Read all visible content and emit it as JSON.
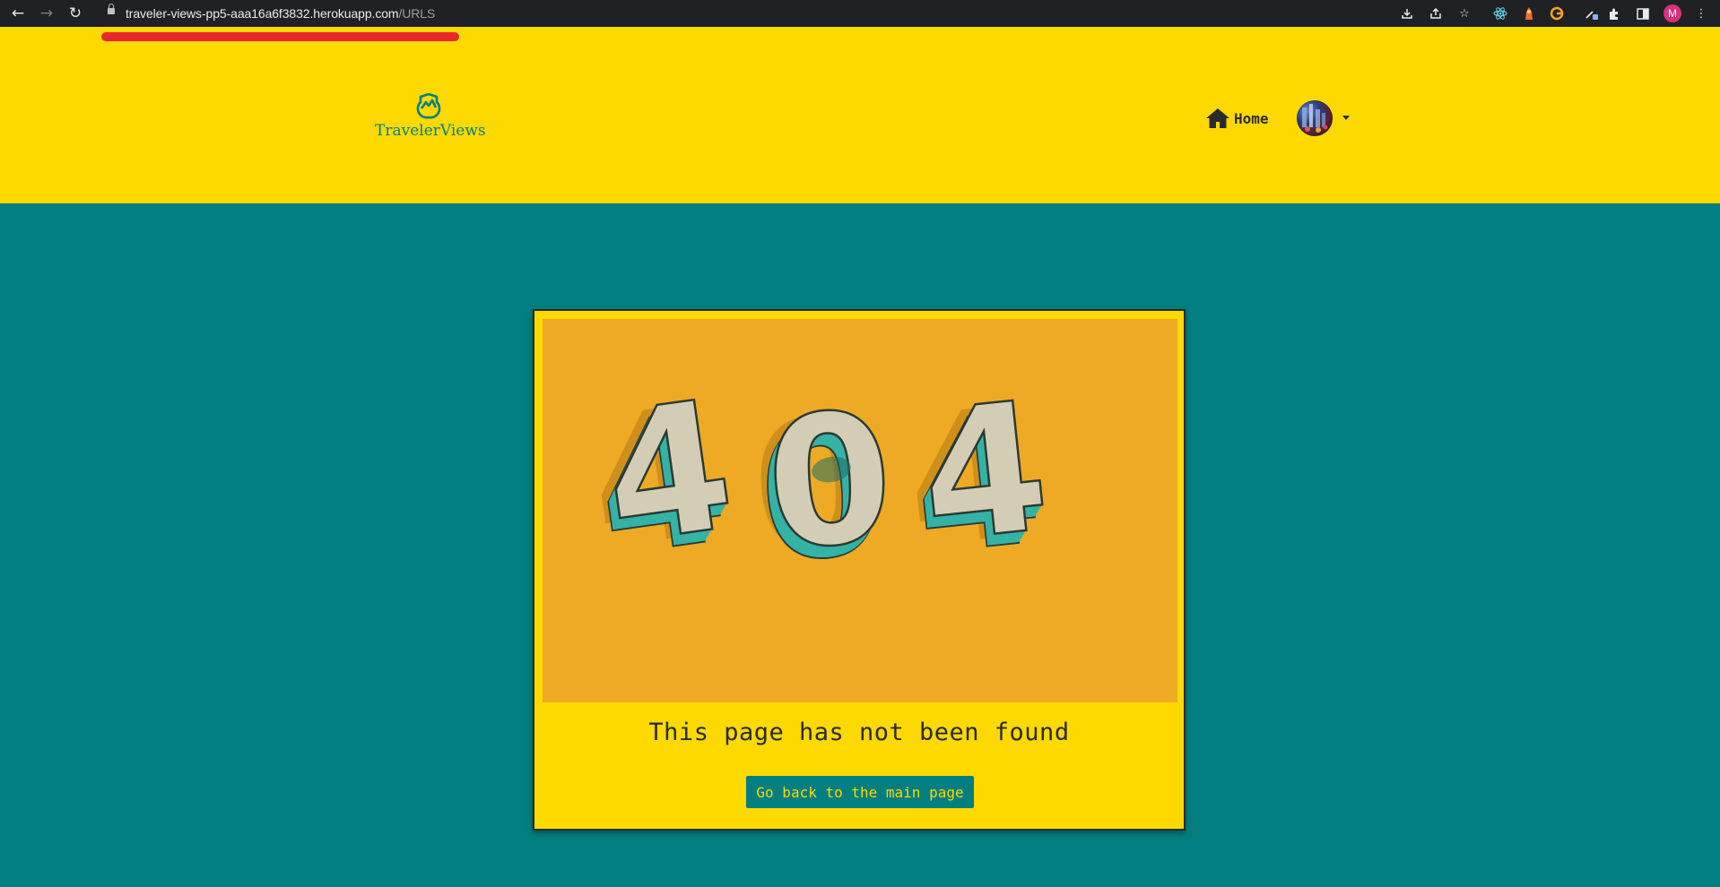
{
  "browser": {
    "url_host": "traveler-views-pp5-aaa16a6f3832.herokuapp.com",
    "url_path": "/URLS",
    "profile_initial": "M",
    "toolbar_icons": [
      "download-icon",
      "share-icon",
      "bookmark-star-icon",
      "react-devtools-icon",
      "extension-icon",
      "grammarly-icon",
      "eyedropper-icon",
      "puzzle-extensions-icon",
      "side-panel-icon",
      "profile-avatar",
      "kebab-menu-icon"
    ]
  },
  "header": {
    "brand_name": "TravelerViews",
    "nav_home_label": "Home"
  },
  "error_page": {
    "illustration_text": "404",
    "message": "This page has not been found",
    "button_label": "Go back to the main page"
  },
  "colors": {
    "header_bg": "#fdd900",
    "page_bg": "#017f80",
    "illustration_bg": "#eeaa24",
    "digit_face": "#d4cdb5",
    "digit_side": "#35b3a5",
    "brand": "#017f80"
  }
}
